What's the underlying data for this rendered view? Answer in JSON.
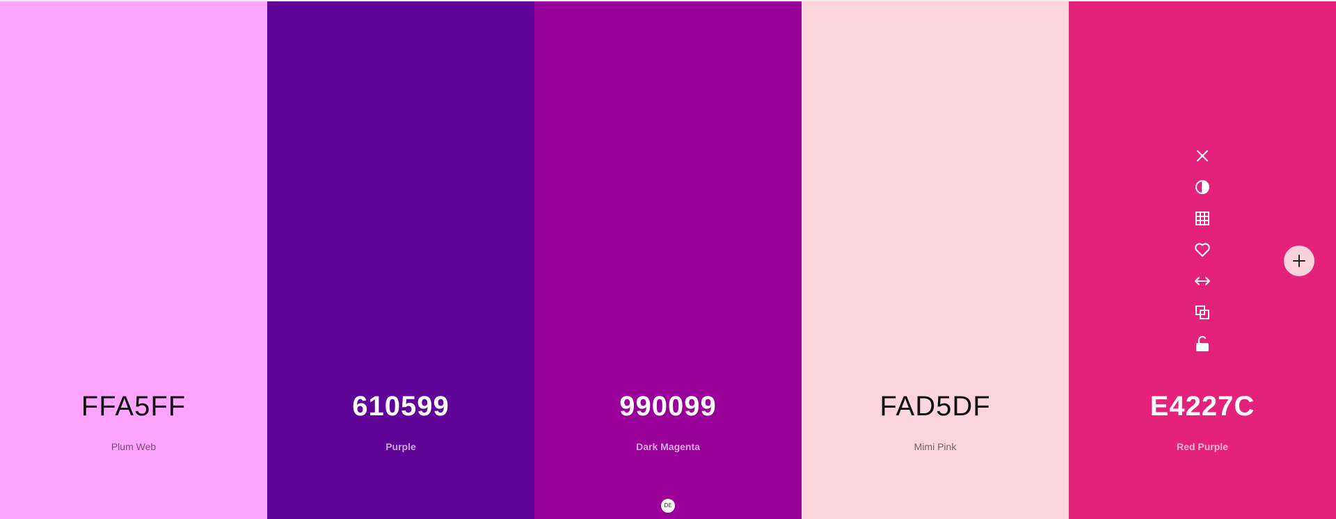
{
  "palette": {
    "colors": [
      {
        "hex": "FFA5FF",
        "name": "Plum Web",
        "bg": "#ffa5ff",
        "text_theme": "dark"
      },
      {
        "hex": "610599",
        "name": "Purple",
        "bg": "#610599",
        "text_theme": "light"
      },
      {
        "hex": "990099",
        "name": "Dark Magenta",
        "bg": "#990099",
        "text_theme": "light"
      },
      {
        "hex": "FAD5DF",
        "name": "Mimi Pink",
        "bg": "#fad5df",
        "text_theme": "dark"
      },
      {
        "hex": "E4227C",
        "name": "Red Purple",
        "bg": "#e4227c",
        "text_theme": "light"
      }
    ]
  },
  "toolbar": {
    "icons": [
      "close-icon",
      "contrast-icon",
      "grid-icon",
      "heart-icon",
      "resize-horizontal-icon",
      "copy-icon",
      "unlock-icon"
    ],
    "icon_color": "#ffffff"
  },
  "add_button": {
    "icon": "plus-icon",
    "bg": "#f9d3dc"
  },
  "badge": {
    "text": "DE"
  }
}
